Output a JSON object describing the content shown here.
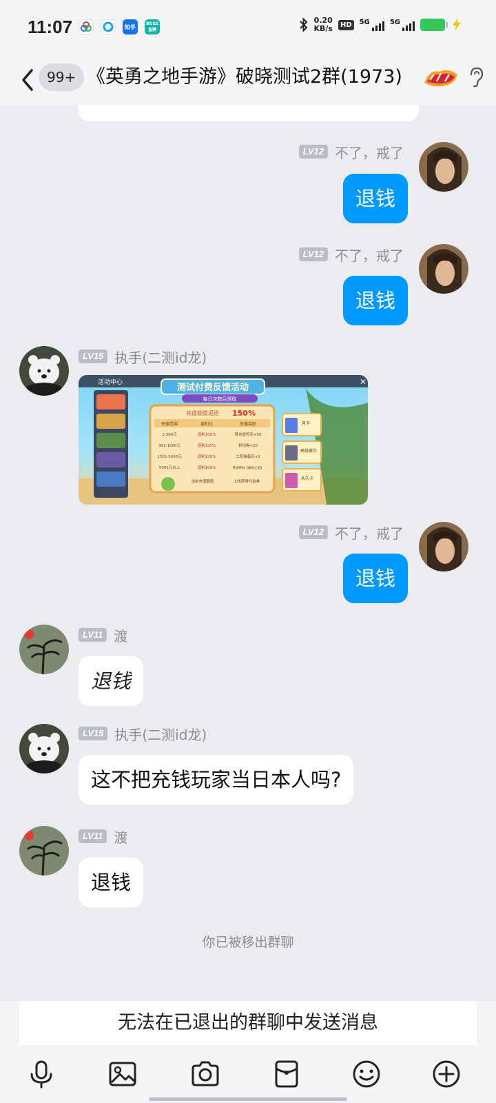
{
  "status_bar": {
    "time": "11:07",
    "apps": [
      {
        "icon": "colorful-rings-app-icon",
        "label": "",
        "color": "#ffffff"
      },
      {
        "icon": "browser-app-icon",
        "label": "",
        "color": "#1aa3ff"
      },
      {
        "icon": "zhihu-app-icon",
        "label": "知乎",
        "color": "#1772f6"
      },
      {
        "icon": "boss-zhipin-app-icon",
        "label": "BOSS直聘",
        "color": "#15b3a8"
      }
    ],
    "net_speed_value": "0.20",
    "net_speed_unit": "KB/s",
    "hd_label": "HD",
    "sim1_label": "5G",
    "sim2_label": "5G",
    "battery_color": "#34c759"
  },
  "header": {
    "unread_count": "99+",
    "title": "《英勇之地手游》破晓测试2群(1973)"
  },
  "messages": [
    {
      "side": "right",
      "level": "LV12",
      "nickname": "不了，戒了",
      "text": "退钱"
    },
    {
      "side": "right",
      "level": "LV12",
      "nickname": "不了，戒了",
      "text": "退钱"
    },
    {
      "side": "left",
      "level": "LV15",
      "nickname": "执手(二测id龙)",
      "type": "image",
      "image": {
        "sidebar_title": "活动中心",
        "banner_title": "测试付费反馈活动",
        "banner_sub": "每日次数后领取",
        "table_title": "充值额度返还",
        "table_percent": "150%",
        "headers": [
          "充值范围",
          "返利比",
          "充值奖励"
        ],
        "rows": [
          [
            "1-300元",
            "返利150%",
            "首充冒险币×50"
          ],
          [
            "301-1500元",
            "返利135%",
            "折扣券×20"
          ],
          [
            "1501-5000元",
            "返利120%",
            "二阶装备石×2"
          ],
          [
            "5001元以上",
            "返利100%",
            "传送特效【破晓之语】"
          ]
        ],
        "footer_left": "当前充值额度",
        "footer_right": "上线获得代金券",
        "cards": [
          "月卡",
          "高级豪华",
          "永久卡"
        ]
      }
    },
    {
      "side": "right",
      "level": "LV12",
      "nickname": "不了，戒了",
      "text": "退钱"
    },
    {
      "side": "left",
      "level": "LV11",
      "nickname": "渡",
      "text": "退钱",
      "style": "handwriting"
    },
    {
      "side": "left",
      "level": "LV15",
      "nickname": "执手(二测id龙)",
      "text": "这不把充钱玩家当日本人吗?"
    },
    {
      "side": "left",
      "level": "LV11",
      "nickname": "渡",
      "text": "退钱"
    }
  ],
  "system_tip": "你已被移出群聊",
  "input_placeholder": "无法在已退出的群聊中发送消息",
  "toolbar": [
    "microphone-icon",
    "image-icon",
    "camera-icon",
    "red-packet-icon",
    "emoji-icon",
    "plus-icon"
  ],
  "colors": {
    "accent": "#0099ff",
    "background": "#ebecf0",
    "level_badge": "#b9bdca"
  }
}
